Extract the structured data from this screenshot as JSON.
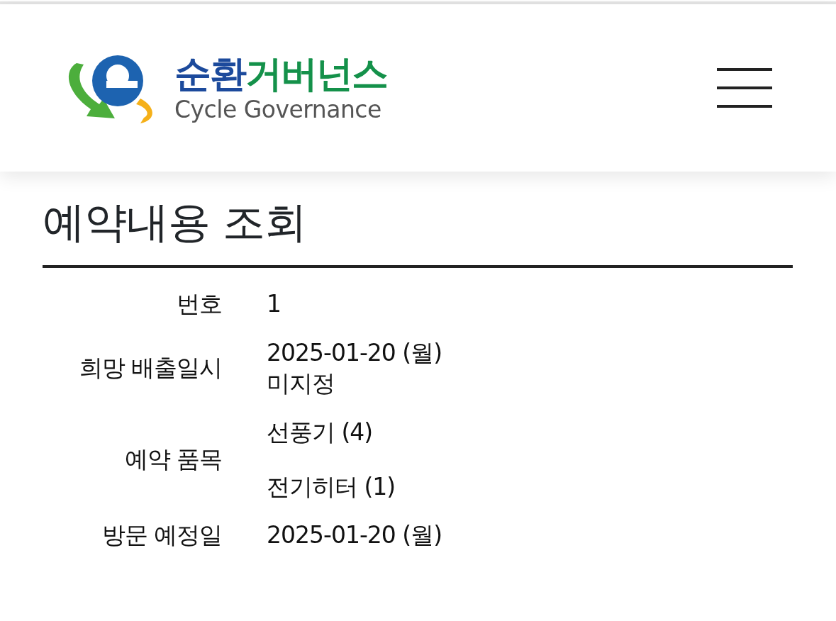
{
  "logo": {
    "name_parts": [
      "순환",
      "거버넌스"
    ],
    "subtitle": "Cycle Governance"
  },
  "title": "예약내용 조회",
  "rows": [
    {
      "label": "번호",
      "values": [
        "1"
      ]
    },
    {
      "label": "희망 배출일시",
      "values": [
        "2025-01-20 (월)",
        "미지정"
      ]
    },
    {
      "label": "예약 품목",
      "values": [
        "선풍기 (4)",
        "전기히터 (1)"
      ]
    },
    {
      "label": "방문 예정일",
      "values": [
        "2025-01-20 (월)"
      ]
    }
  ]
}
